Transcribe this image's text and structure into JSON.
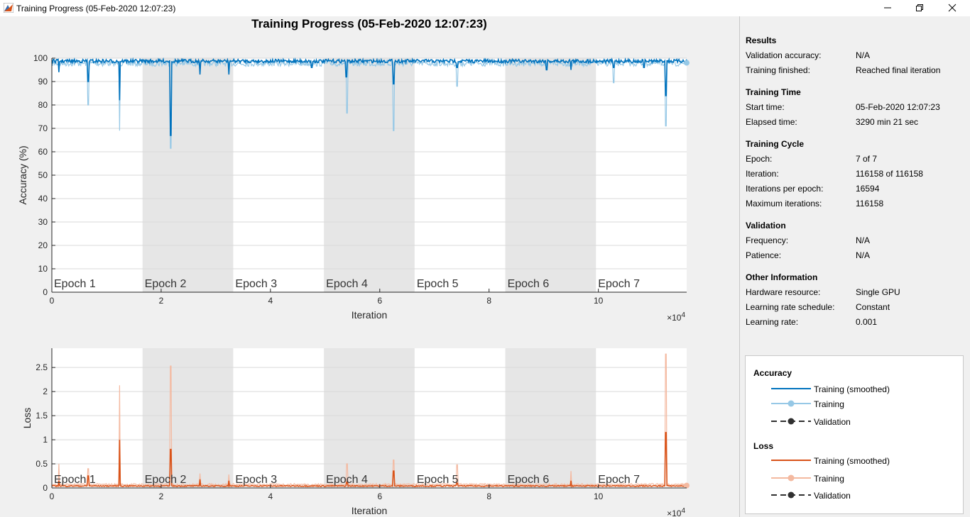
{
  "window": {
    "title": "Training Progress (05-Feb-2020 12:07:23)",
    "controls": [
      "minimize-icon",
      "restore-icon",
      "close-icon"
    ]
  },
  "plot_title": "Training Progress (05-Feb-2020 12:07:23)",
  "colors": {
    "accuracy_smoothed": "#0072bd",
    "accuracy_raw": "#96c8e6",
    "loss_smoothed": "#d95319",
    "loss_raw": "#f4b9a0",
    "epoch_shade": "#e6e6e6",
    "validation": "#303030"
  },
  "chart_data": [
    {
      "type": "line",
      "xlabel": "Iteration",
      "ylabel": "Accuracy (%)",
      "xlim": [
        0,
        116158
      ],
      "ylim": [
        0,
        100
      ],
      "x_ticks": [
        0,
        20000,
        40000,
        60000,
        80000,
        100000
      ],
      "x_tick_labels": [
        "0",
        "2",
        "4",
        "6",
        "8",
        "10"
      ],
      "x_multiplier": "×10",
      "x_multiplier_exp": "4",
      "y_ticks": [
        0,
        10,
        20,
        30,
        40,
        50,
        60,
        70,
        80,
        90,
        100
      ],
      "y_tick_labels": [
        "0",
        "10",
        "20",
        "30",
        "40",
        "50",
        "60",
        "70",
        "80",
        "90",
        "100"
      ],
      "epochs": [
        "Epoch 1",
        "Epoch 2",
        "Epoch 3",
        "Epoch 4",
        "Epoch 5",
        "Epoch 6",
        "Epoch 7"
      ],
      "iterations_per_epoch": 16594,
      "series": [
        {
          "name": "Training (smoothed)",
          "baseline": 99.5,
          "dips": [
            [
              1300,
              94
            ],
            [
              6600,
              90
            ],
            [
              12400,
              82
            ],
            [
              21700,
              67
            ],
            [
              27100,
              93
            ],
            [
              32400,
              93
            ],
            [
              47600,
              96
            ],
            [
              53900,
              92
            ],
            [
              62500,
              89
            ],
            [
              74100,
              96
            ],
            [
              90500,
              95
            ],
            [
              95000,
              95
            ],
            [
              102800,
              96
            ],
            [
              108400,
              96
            ],
            [
              112400,
              84
            ]
          ]
        },
        {
          "name": "Training",
          "baseline": 99,
          "dips": [
            [
              6600,
              80
            ],
            [
              12400,
              69
            ],
            [
              21700,
              61.5
            ],
            [
              54000,
              76.5
            ],
            [
              62500,
              69
            ],
            [
              74100,
              88
            ],
            [
              102800,
              89.5
            ],
            [
              112400,
              71
            ]
          ]
        },
        {
          "name": "Validation",
          "values": []
        }
      ]
    },
    {
      "type": "line",
      "xlabel": "Iteration",
      "ylabel": "Loss",
      "xlim": [
        0,
        116158
      ],
      "ylim": [
        0,
        2.9
      ],
      "x_ticks": [
        0,
        20000,
        40000,
        60000,
        80000,
        100000
      ],
      "x_tick_labels": [
        "0",
        "2",
        "4",
        "6",
        "8",
        "10"
      ],
      "x_multiplier": "×10",
      "x_multiplier_exp": "4",
      "y_ticks": [
        0,
        0.5,
        1,
        1.5,
        2,
        2.5
      ],
      "y_tick_labels": [
        "0",
        "0.5",
        "1",
        "1.5",
        "2",
        "2.5"
      ],
      "epochs": [
        "Epoch 1",
        "Epoch 2",
        "Epoch 3",
        "Epoch 4",
        "Epoch 5",
        "Epoch 6",
        "Epoch 7"
      ],
      "iterations_per_epoch": 16594,
      "series": [
        {
          "name": "Training (smoothed)",
          "baseline": 0.03,
          "spikes": [
            [
              1300,
              0.15
            ],
            [
              6600,
              0.25
            ],
            [
              12400,
              1.0
            ],
            [
              21700,
              0.8
            ],
            [
              27100,
              0.18
            ],
            [
              32400,
              0.15
            ],
            [
              54000,
              0.12
            ],
            [
              62500,
              0.35
            ],
            [
              74100,
              0.1
            ],
            [
              95000,
              0.15
            ],
            [
              112400,
              1.15
            ]
          ]
        },
        {
          "name": "Training",
          "baseline": 0.05,
          "spikes": [
            [
              1300,
              0.5
            ],
            [
              6600,
              0.4
            ],
            [
              12400,
              2.13
            ],
            [
              21700,
              2.53
            ],
            [
              27100,
              0.3
            ],
            [
              32400,
              0.28
            ],
            [
              54000,
              0.5
            ],
            [
              62500,
              0.58
            ],
            [
              74100,
              0.48
            ],
            [
              95000,
              0.35
            ],
            [
              112400,
              2.78
            ]
          ]
        },
        {
          "name": "Validation",
          "values": []
        }
      ]
    }
  ],
  "info": {
    "results": {
      "heading": "Results",
      "rows": [
        {
          "label": "Validation accuracy:",
          "value": "N/A"
        },
        {
          "label": "Training finished:",
          "value": "Reached final iteration"
        }
      ]
    },
    "training_time": {
      "heading": "Training Time",
      "rows": [
        {
          "label": "Start time:",
          "value": "05-Feb-2020 12:07:23"
        },
        {
          "label": "Elapsed time:",
          "value": "3290 min 21 sec"
        }
      ]
    },
    "training_cycle": {
      "heading": "Training Cycle",
      "rows": [
        {
          "label": "Epoch:",
          "value": "7 of 7"
        },
        {
          "label": "Iteration:",
          "value": "116158 of 116158"
        },
        {
          "label": "Iterations per epoch:",
          "value": "16594"
        },
        {
          "label": "Maximum iterations:",
          "value": "116158"
        }
      ]
    },
    "validation": {
      "heading": "Validation",
      "rows": [
        {
          "label": "Frequency:",
          "value": "N/A"
        },
        {
          "label": "Patience:",
          "value": "N/A"
        }
      ]
    },
    "other": {
      "heading": "Other Information",
      "rows": [
        {
          "label": "Hardware resource:",
          "value": "Single GPU"
        },
        {
          "label": "Learning rate schedule:",
          "value": "Constant"
        },
        {
          "label": "Learning rate:",
          "value": "0.001"
        }
      ]
    }
  },
  "legend": {
    "accuracy": {
      "heading": "Accuracy",
      "items": [
        "Training (smoothed)",
        "Training",
        "Validation"
      ]
    },
    "loss": {
      "heading": "Loss",
      "items": [
        "Training (smoothed)",
        "Training",
        "Validation"
      ]
    }
  }
}
